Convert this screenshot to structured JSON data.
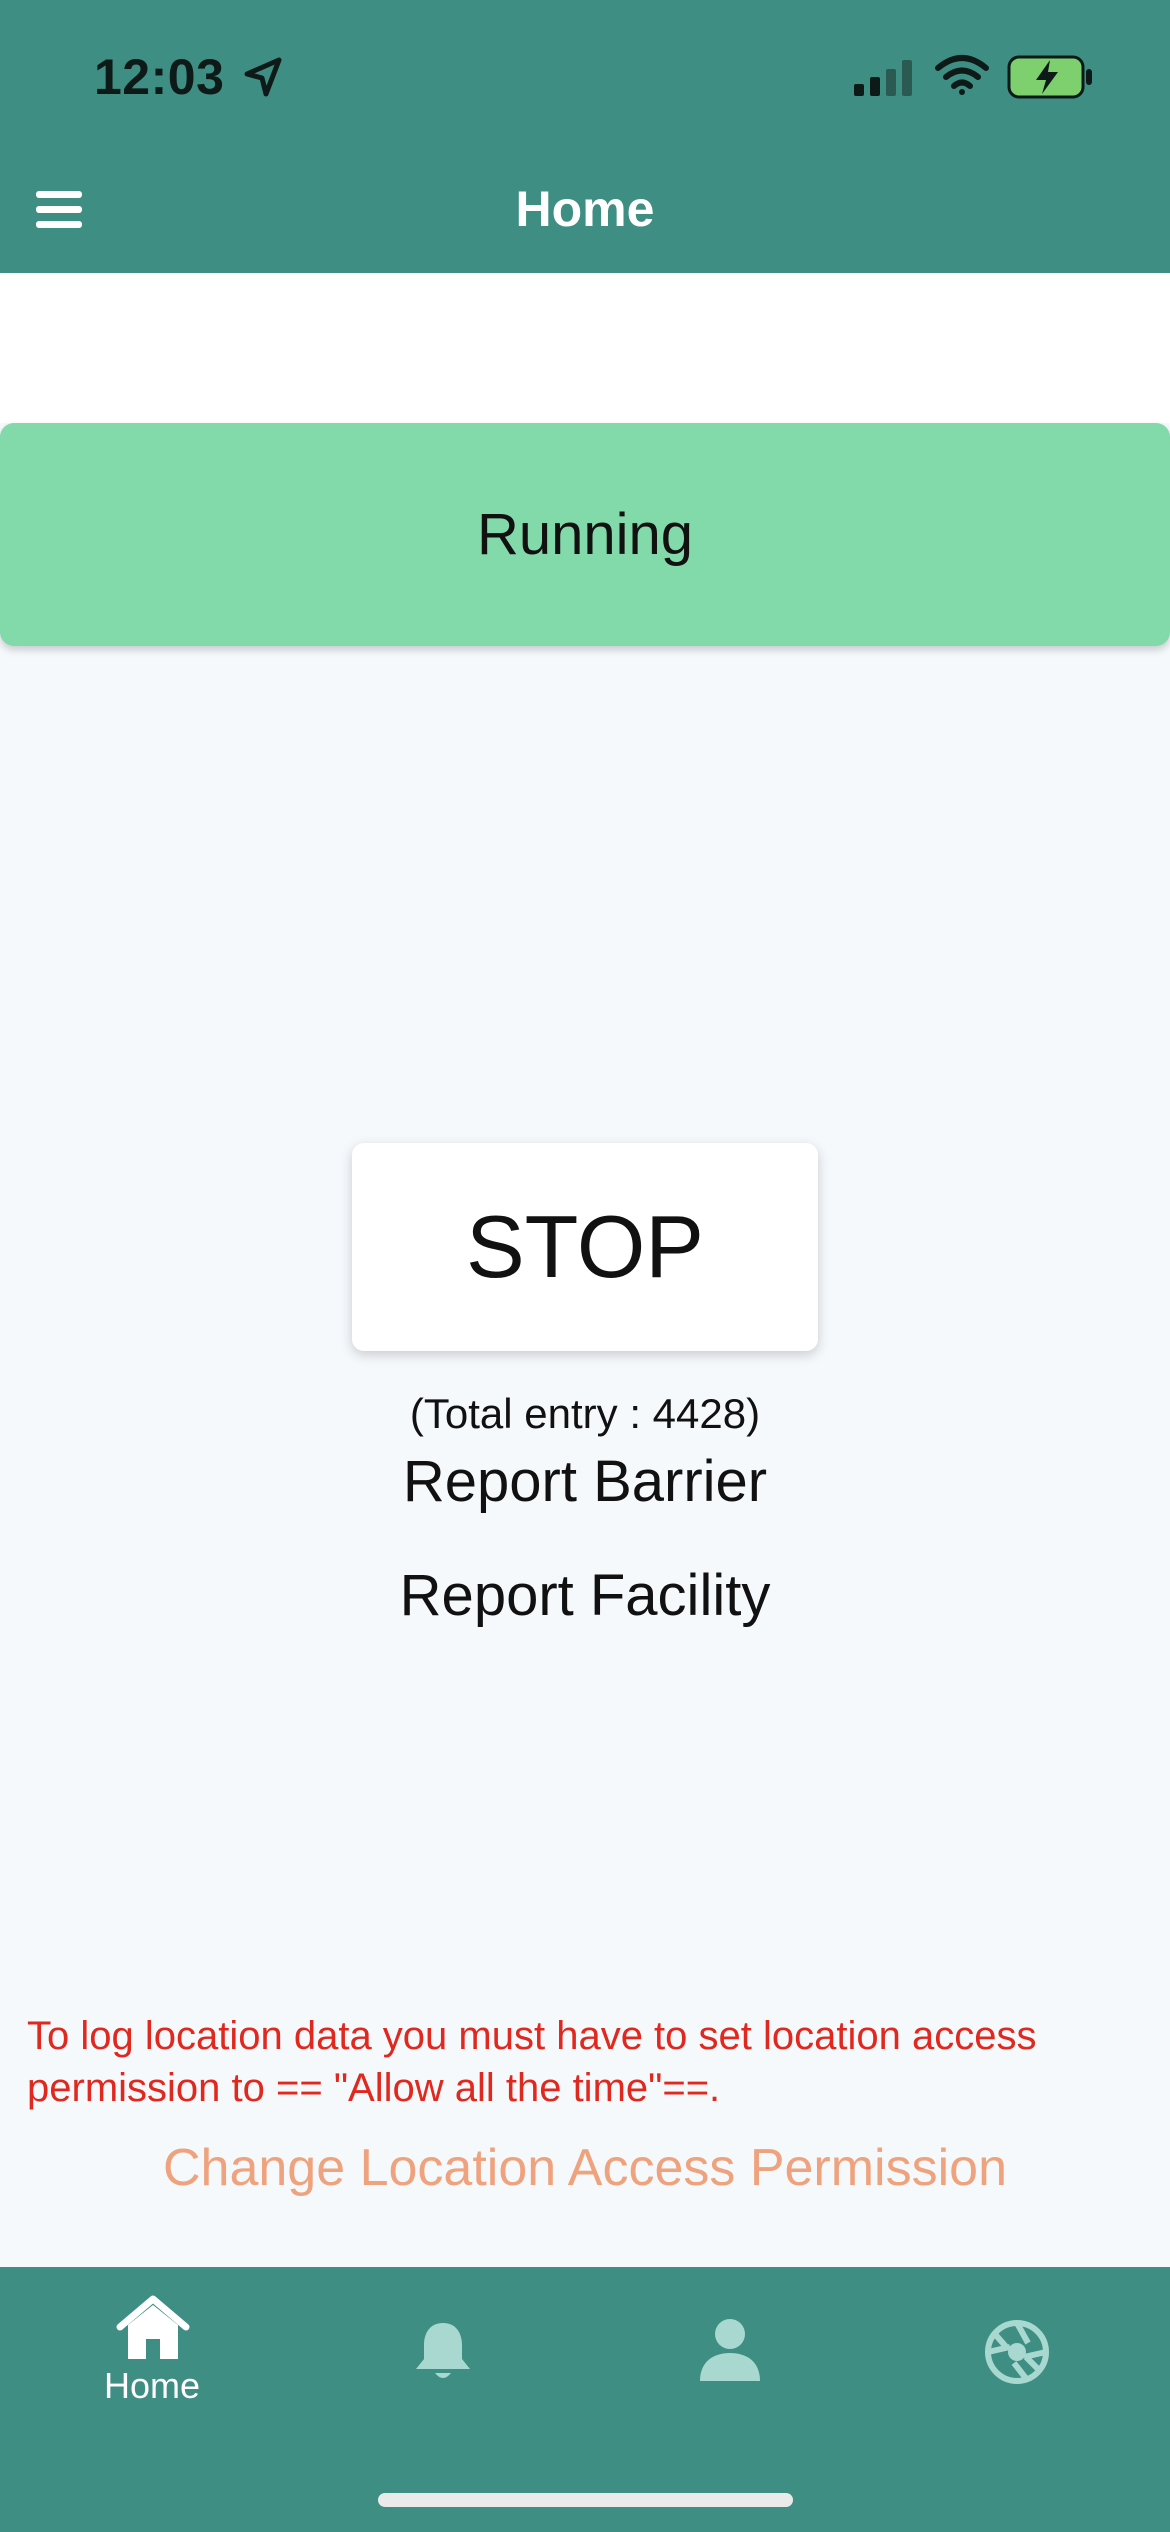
{
  "status_bar": {
    "time": "12:03",
    "location_icon": "location-arrow-icon",
    "signal_icon": "cellular-signal-icon",
    "wifi_icon": "wifi-icon",
    "battery_icon": "battery-charging-icon"
  },
  "nav": {
    "title": "Home",
    "menu_icon": "hamburger-menu-icon"
  },
  "status_banner": {
    "label": "Running",
    "color": "#82d9a9"
  },
  "main": {
    "stop_label": "STOP",
    "total_entry": "(Total entry : 4428)",
    "report_barrier": "Report Barrier",
    "report_facility": "Report Facility"
  },
  "permission": {
    "warning": "To log location data you must have to set location access permission to == \"Allow all the time\"==.",
    "change_link": "Change Location Access Permission",
    "warning_color": "#e0281e",
    "link_color": "#eea37e"
  },
  "tabs": [
    {
      "label": "Home",
      "icon": "home-icon",
      "active": true
    },
    {
      "label": "",
      "icon": "bell-icon",
      "active": false
    },
    {
      "label": "",
      "icon": "person-icon",
      "active": false
    },
    {
      "label": "",
      "icon": "camera-aperture-icon",
      "active": false
    }
  ],
  "colors": {
    "primary": "#3f8e84",
    "background": "#f5f9fc"
  }
}
